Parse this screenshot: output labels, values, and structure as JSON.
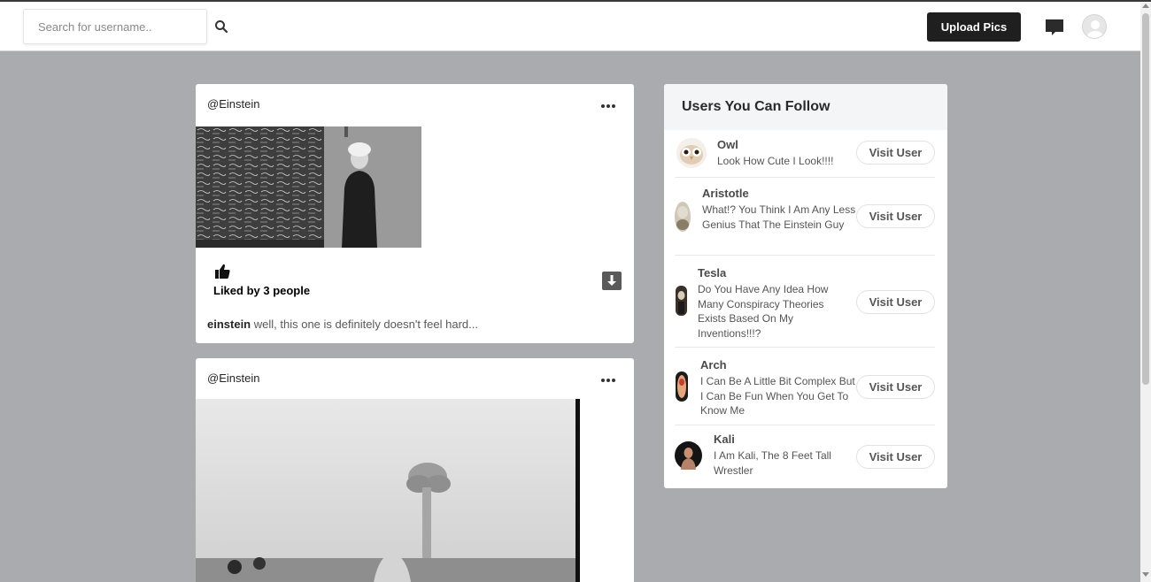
{
  "search": {
    "placeholder": "Search for username.."
  },
  "header": {
    "upload_label": "Upload Pics"
  },
  "posts": [
    {
      "username": "@Einstein",
      "liked_by": "Liked by 3 people",
      "caption_user": "einstein",
      "caption_text": "well, this one is definitely doesn't feel hard..."
    },
    {
      "username": "@Einstein"
    }
  ],
  "suggestions": {
    "title": "Users You Can Follow",
    "button_label": "Visit User",
    "users": [
      {
        "name": "Owl",
        "bio": "Look How Cute I Look!!!!"
      },
      {
        "name": "Aristotle",
        "bio": "What!? You Think I Am Any Less Genius That The Einstein Guy"
      },
      {
        "name": "Tesla",
        "bio": "Do You Have Any Idea How Many Conspiracy Theories Exists Based On My Inventions!!!?"
      },
      {
        "name": "Arch",
        "bio": "I Can Be A Little Bit Complex But I Can Be Fun When You Get To Know Me"
      },
      {
        "name": "Kali",
        "bio": "I Am Kali, The 8 Feet Tall Wrestler"
      }
    ]
  },
  "colors": {
    "background": "#a9abae",
    "upload_button": "#1f1f1f",
    "card": "#ffffff"
  },
  "icons": [
    "search-icon",
    "message-icon",
    "profile-avatar",
    "more-options-icon",
    "like-icon",
    "download-icon"
  ]
}
